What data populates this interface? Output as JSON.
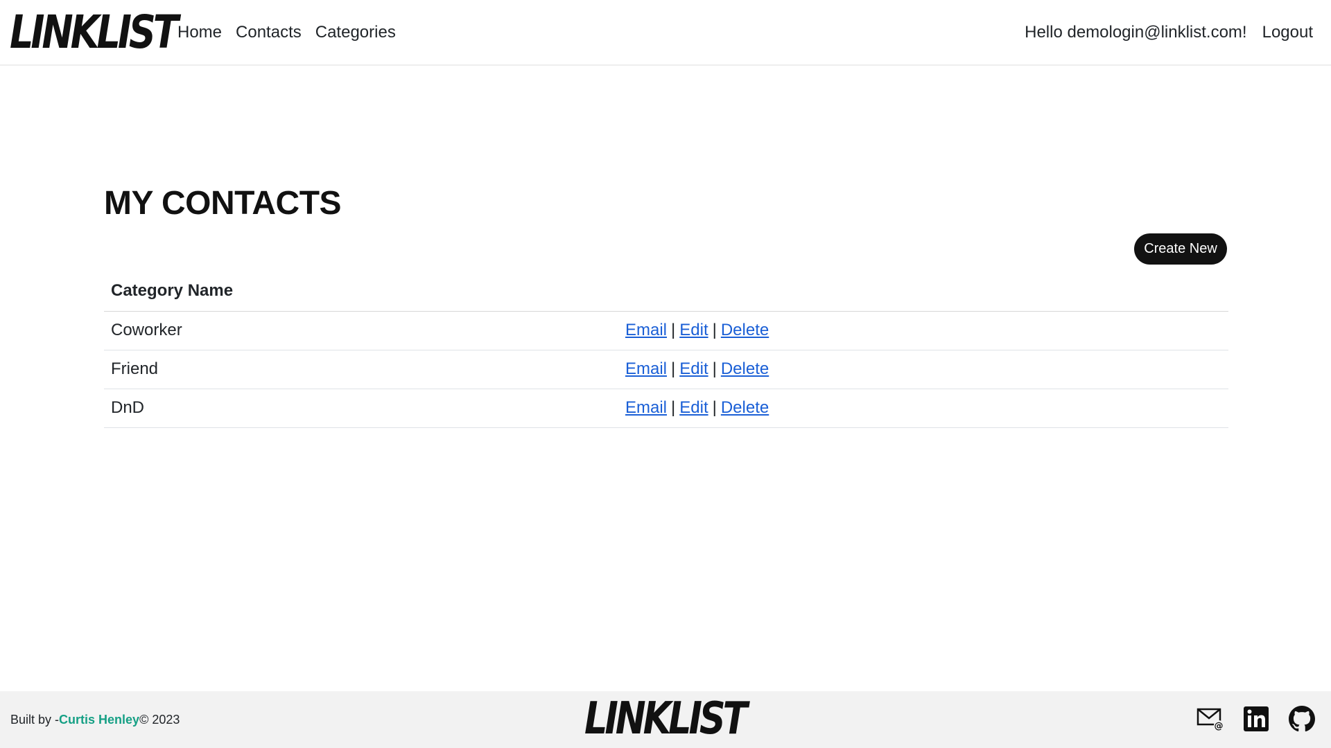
{
  "header": {
    "logo": "LINKLIST",
    "nav": [
      "Home",
      "Contacts",
      "Categories"
    ],
    "greeting": "Hello demologin@linklist.com!",
    "logout": "Logout"
  },
  "main": {
    "title": "MY CONTACTS",
    "create_button": "Create New",
    "table": {
      "header": "Category Name",
      "rows": [
        {
          "name": "Coworker",
          "email": "Email",
          "edit": "Edit",
          "delete": "Delete"
        },
        {
          "name": "Friend",
          "email": "Email",
          "edit": "Edit",
          "delete": "Delete"
        },
        {
          "name": "DnD",
          "email": "Email",
          "edit": "Edit",
          "delete": "Delete"
        }
      ],
      "separator": "|"
    }
  },
  "footer": {
    "built_by": "Built by -",
    "author": "Curtis Henley",
    "copyright": "© 2023",
    "logo": "LINKLIST",
    "icons": [
      "email-icon",
      "linkedin-icon",
      "github-icon"
    ]
  },
  "colors": {
    "link": "#1a5fd6",
    "author": "#16a085",
    "button_bg": "#121212",
    "footer_bg": "#f2f2f2"
  }
}
